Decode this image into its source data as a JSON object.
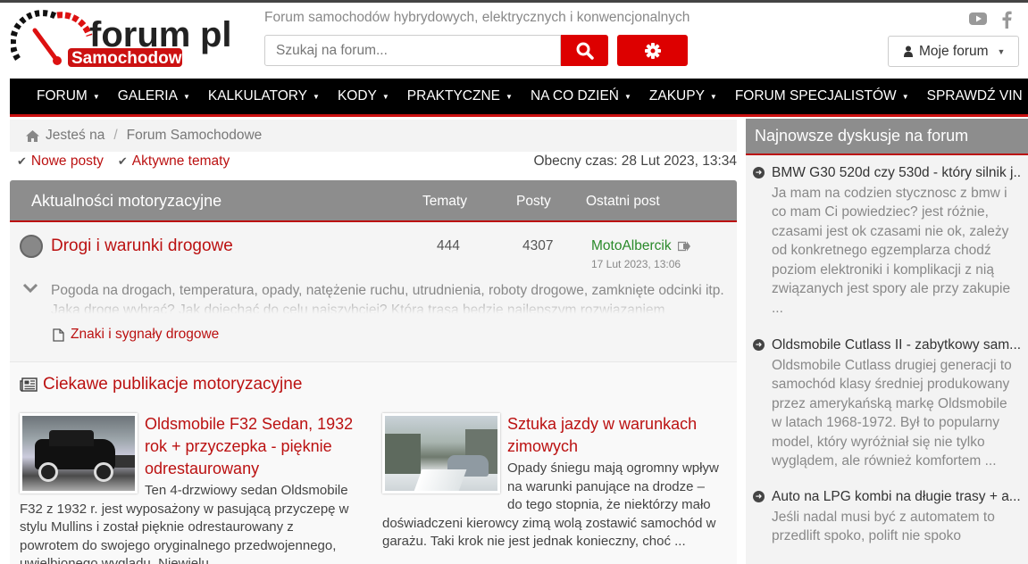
{
  "header": {
    "logo_text_top": "forum",
    "logo_text_pl": "pl",
    "logo_text_bottom": "Samochodowe",
    "tagline": "Forum samochodów hybrydowych, elektrycznych i konwencjonalnych",
    "search_placeholder": "Szukaj na forum...",
    "my_forum_label": "Moje forum",
    "accent_color": "#dd0000"
  },
  "nav": {
    "items": [
      {
        "label": "FORUM",
        "dropdown": true
      },
      {
        "label": "GALERIA",
        "dropdown": true
      },
      {
        "label": "KALKULATORY",
        "dropdown": true
      },
      {
        "label": "KODY",
        "dropdown": true
      },
      {
        "label": "PRAKTYCZNE",
        "dropdown": true
      },
      {
        "label": "NA CO DZIEŃ",
        "dropdown": true
      },
      {
        "label": "ZAKUPY",
        "dropdown": true
      },
      {
        "label": "FORUM SPECJALISTÓW",
        "dropdown": true
      },
      {
        "label": "SPRAWDŹ VIN",
        "dropdown": false
      }
    ]
  },
  "breadcrumb": {
    "home": "Jesteś na",
    "current": "Forum Samochodowe"
  },
  "quick_links": {
    "new_posts": "Nowe posty",
    "active_topics": "Aktywne tematy"
  },
  "current_time": "Obecny czas: 28 Lut 2023, 13:34",
  "forum_table": {
    "category": "Aktualności motoryzacyjne",
    "col_topics": "Tematy",
    "col_posts": "Posty",
    "col_last": "Ostatni post",
    "forum": {
      "title": "Drogi i warunki drogowe",
      "topics": "444",
      "posts": "4307",
      "last_user": "MotoAlbercik",
      "last_date": "17 Lut 2023, 13:06",
      "description": "Pogoda na drogach, temperatura, opady, natężenie ruchu, utrudnienia, roboty drogowe, zamknięte odcinki itp. Jaką drogę wybrać? Jak dojechać do celu najszybciej? Która trasa będzie najlepszym rozwiązaniem",
      "subforum": "Znaki i sygnały drogowe"
    }
  },
  "publications": {
    "heading": "Ciekawe publikacje motoryzacyjne",
    "articles": [
      {
        "title": "Oldsmobile F32 Sedan, 1932 rok + przyczepka - pięknie odrestaurowany",
        "excerpt": "Ten 4-drzwiowy sedan Oldsmobile F32 z 1932 r. jest wyposażony w pasującą przyczepę w stylu Mullins i został pięknie odrestaurowany z powrotem do swojego oryginalnego przedwojennego, uwielbionego wyglądu. Niewielu"
      },
      {
        "title": "Sztuka jazdy w warunkach zimowych",
        "excerpt": "Opady śniegu mają ogromny wpływ na warunki panujące na drodze – do tego stopnia, że niektórzy mało doświadczeni kierowcy zimą wolą zostawić samochód w garażu. Taki krok nie jest jednak konieczny, choć ..."
      }
    ]
  },
  "sidebar": {
    "heading": "Najnowsze dyskusje na forum",
    "items": [
      {
        "title": "BMW G30 520d czy 530d - który silnik j...",
        "excerpt": "Ja mam na codzien stycznosc z bmw i co mam Ci powiedziec? jest różnie, czasami jest ok czasami nie ok, zależy od konkretnego egzemplarza chodź poziom elektroniki i komplikacji z nią związanych jest spory ale przy zakupie ..."
      },
      {
        "title": "Oldsmobile Cutlass II - zabytkowy sam...",
        "excerpt": "Oldsmobile Cutlass drugiej generacji to samochód klasy średniej produkowany przez amerykańską markę Oldsmobile w latach 1968-1972. Był to popularny model, który wyróżniał się nie tylko wyglądem, ale również komfortem ..."
      },
      {
        "title": "Auto na LPG kombi na długie trasy + a...",
        "excerpt": "Jeśli nadal musi być z automatem to przedlift spoko, polift nie spoko"
      }
    ]
  }
}
